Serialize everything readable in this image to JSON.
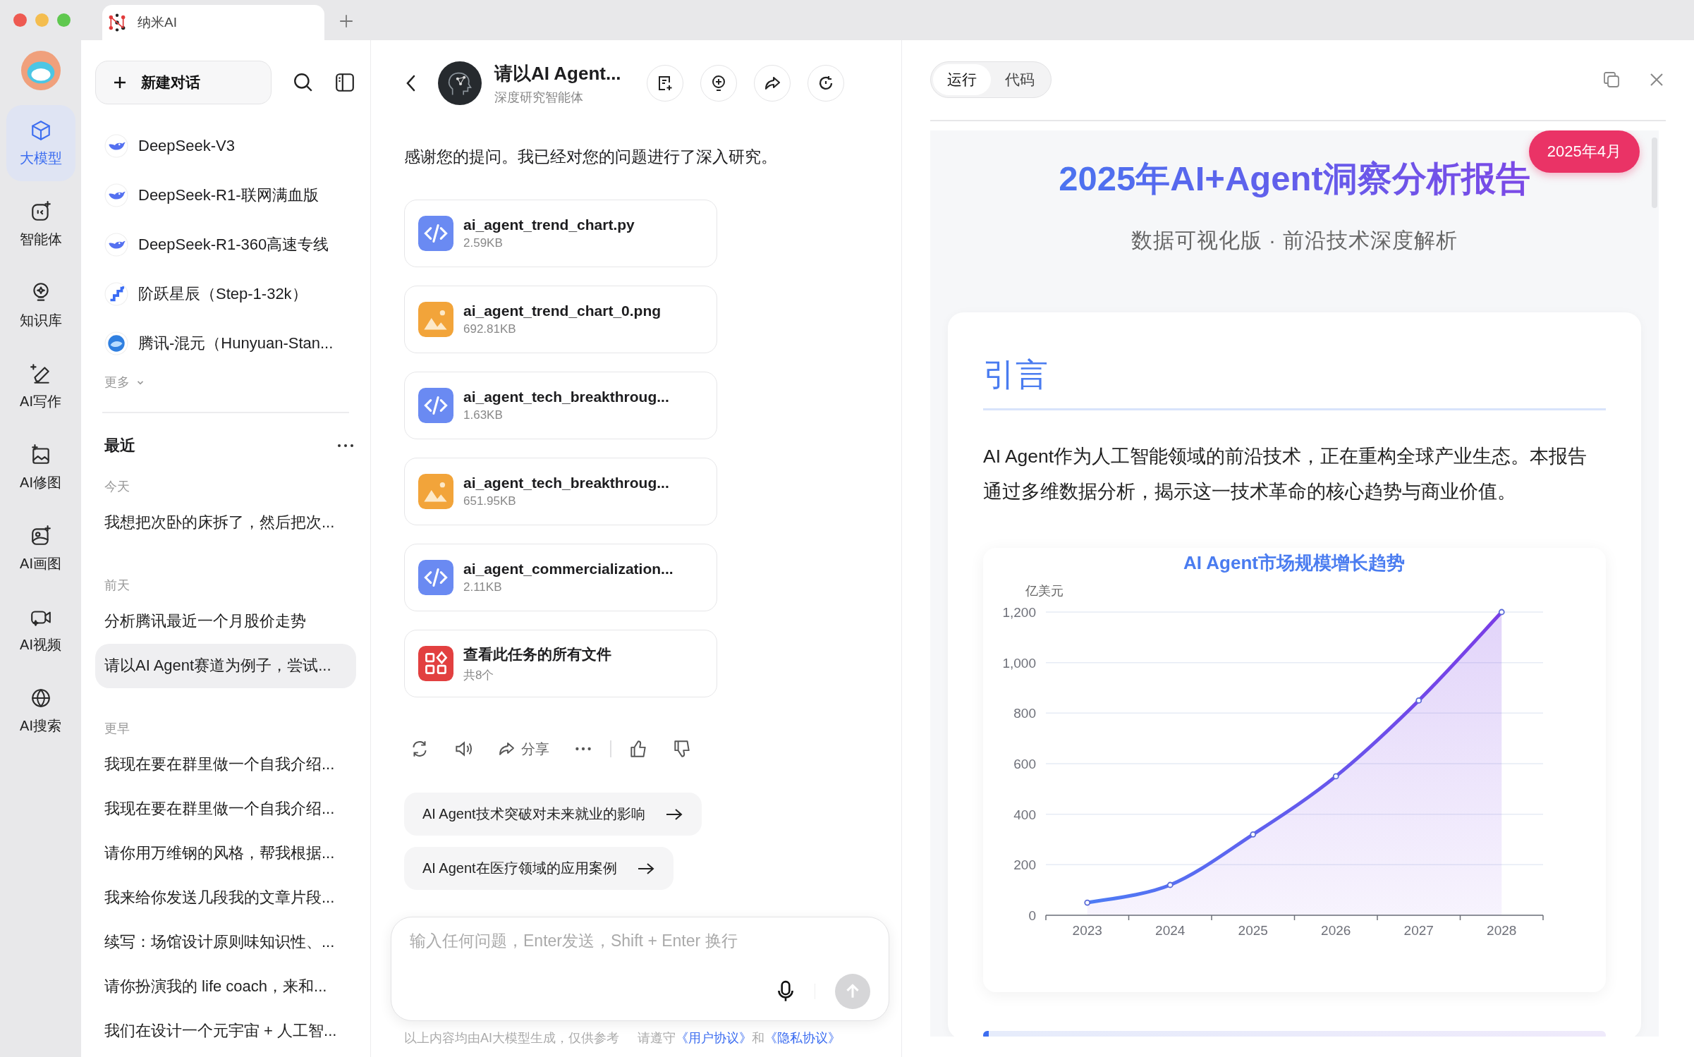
{
  "window": {
    "tab_title": "纳米AI"
  },
  "rail": {
    "items": [
      {
        "label": "大模型",
        "selected": true
      },
      {
        "label": "智能体",
        "selected": false
      },
      {
        "label": "知识库",
        "selected": false
      },
      {
        "label": "AI写作",
        "selected": false
      },
      {
        "label": "AI修图",
        "selected": false
      },
      {
        "label": "AI画图",
        "selected": false
      },
      {
        "label": "AI视频",
        "selected": false
      },
      {
        "label": "AI搜索",
        "selected": false
      }
    ]
  },
  "sidebar": {
    "new_chat": "新建对话",
    "models": [
      {
        "name": "DeepSeek-V3",
        "kind": "whale"
      },
      {
        "name": "DeepSeek-R1-联网满血版",
        "kind": "whale"
      },
      {
        "name": "DeepSeek-R1-360高速专线",
        "kind": "whale"
      },
      {
        "name": "阶跃星辰（Step-1-32k）",
        "kind": "steps"
      },
      {
        "name": "腾讯-混元（Hunyuan-Stan...",
        "kind": "sphere"
      }
    ],
    "more": "更多",
    "recent_title": "最近",
    "groups": [
      {
        "label": "今天",
        "items": [
          {
            "text": "我想把次卧的床拆了，然后把次...",
            "selected": false
          }
        ]
      },
      {
        "label": "前天",
        "items": [
          {
            "text": "分析腾讯最近一个月股价走势",
            "selected": false
          },
          {
            "text": "请以AI Agent赛道为例子，尝试...",
            "selected": true
          }
        ]
      },
      {
        "label": "更早",
        "items": [
          {
            "text": "我现在要在群里做一个自我介绍...",
            "selected": false
          },
          {
            "text": "我现在要在群里做一个自我介绍...",
            "selected": false
          },
          {
            "text": "请你用万维钢的风格，帮我根据...",
            "selected": false
          },
          {
            "text": "我来给你发送几段我的文章片段...",
            "selected": false
          },
          {
            "text": "续写：场馆设计原则味知识性、...",
            "selected": false
          },
          {
            "text": "请你扮演我的 life coach，来和...",
            "selected": false
          },
          {
            "text": "我们在设计一个元宇宙 + 人工智...",
            "selected": false
          }
        ]
      }
    ]
  },
  "chat": {
    "title": "请以AI Agent...",
    "subtitle": "深度研究智能体",
    "message": "感谢您的提问。我已经对您的问题进行了深入研究。",
    "files": [
      {
        "name": "ai_agent_trend_chart.py",
        "size": "2.59KB",
        "kind": "code"
      },
      {
        "name": "ai_agent_trend_chart_0.png",
        "size": "692.81KB",
        "kind": "image"
      },
      {
        "name": "ai_agent_tech_breakthroug...",
        "size": "1.63KB",
        "kind": "code"
      },
      {
        "name": "ai_agent_tech_breakthroug...",
        "size": "651.95KB",
        "kind": "image"
      },
      {
        "name": "ai_agent_commercialization...",
        "size": "2.11KB",
        "kind": "code"
      },
      {
        "name": "查看此任务的所有文件",
        "size": "共8个",
        "kind": "all"
      }
    ],
    "share": "分享",
    "suggestions": [
      "AI Agent技术突破对未来就业的影响",
      "AI Agent在医疗领域的应用案例"
    ],
    "input": {
      "placeholder": "输入任何问题，Enter发送，Shift + Enter 换行"
    },
    "footer": {
      "note": "以上内容均由AI大模型生成，仅供参考",
      "prefix": "请遵守",
      "link1": "《用户协议》",
      "joiner": "和",
      "link2": "《隐私协议》"
    }
  },
  "preview": {
    "tabs": [
      {
        "label": "运行",
        "selected": true
      },
      {
        "label": "代码",
        "selected": false
      }
    ],
    "title": "2025年AI+Agent洞察分析报告",
    "badge": "2025年4月",
    "subtitle": "数据可视化版 · 前沿技术深度解析",
    "section": {
      "heading": "引言",
      "paragraph": "AI Agent作为人工智能领域的前沿技术，正在重构全球产业生态。本报告通过多维数据分析，揭示这一技术革命的核心趋势与商业价值。"
    },
    "chart_data": {
      "type": "area",
      "title": "AI Agent市场规模增长趋势",
      "ylabel": "亿美元",
      "categories": [
        "2023",
        "2024",
        "2025",
        "2026",
        "2027",
        "2028"
      ],
      "series": [
        {
          "color": "#7a3ce6",
          "values": [
            50,
            120,
            320,
            550,
            850,
            1200
          ]
        }
      ],
      "grid": true,
      "ylim": [
        0,
        1200
      ],
      "yticks": [
        0,
        200,
        400,
        600,
        800,
        {
          "value": 1000,
          "label": "1,000"
        },
        {
          "value": 1200,
          "label": "1,200"
        }
      ]
    }
  }
}
